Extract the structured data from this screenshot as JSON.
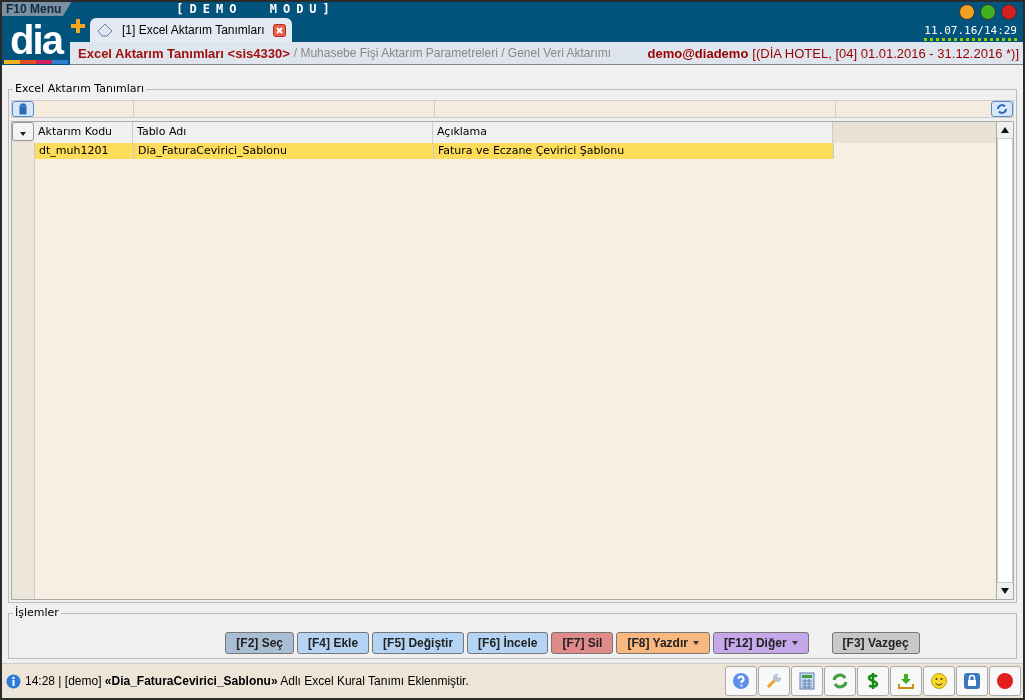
{
  "header": {
    "menu_label": "F10 Menu",
    "mode": "[DEMO MODU]",
    "logo": "dia",
    "datetime": "11.07.16/14:29",
    "window_dots": [
      {
        "color": "#f0a020"
      },
      {
        "color": "#40b020"
      },
      {
        "color": "#d02020"
      }
    ]
  },
  "tabs": [
    {
      "label": "[1] Excel Aktarım Tanımları",
      "selected": true
    }
  ],
  "breadcrumb": {
    "current": "Excel Aktarım Tanımları <sis4330>",
    "path": "/ Muhasebe Fişi Aktarım Parametreleri / Genel Veri Aktarımı",
    "user": "demo@diademo",
    "company": "[(DİA HOTEL, [04] 01.01.2016 - 31.12.2016 *)]"
  },
  "grid": {
    "title": "Excel Aktarım Tanımları",
    "columns": [
      "Aktarım Kodu",
      "Tablo Adı",
      "Açıklama"
    ],
    "rows": [
      {
        "cells": [
          "dt_muh1201",
          "Dia_FaturaCevirici_Sablonu",
          "Fatura ve Eczane Çevirici Şablonu"
        ],
        "selected": true
      }
    ]
  },
  "actions": {
    "title": "İşlemler",
    "buttons": [
      {
        "label": "[F2] Seç",
        "color": "#a9bdd3",
        "menu": false
      },
      {
        "label": "[F4] Ekle",
        "color": "#b5d3f3",
        "menu": false
      },
      {
        "label": "[F5] Değiştir",
        "color": "#b5d3f3",
        "menu": false
      },
      {
        "label": "[F6] İncele",
        "color": "#b5d3f3",
        "menu": false
      },
      {
        "label": "[F7] Sil",
        "color": "#e08a8a",
        "menu": false
      },
      {
        "label": "[F8] Yazdır",
        "color": "#f8b880",
        "menu": true
      },
      {
        "label": "[F12] Diğer",
        "color": "#c4a8ea",
        "menu": true
      },
      {
        "label": "[F3] Vazgeç",
        "color": "#c8c8c8",
        "menu": false
      }
    ]
  },
  "status": {
    "message": "14:28 | [demo] **«Dia_FaturaCevirici_Sablonu»** Adlı Excel Kural Tanımı Eklenmiştir."
  }
}
